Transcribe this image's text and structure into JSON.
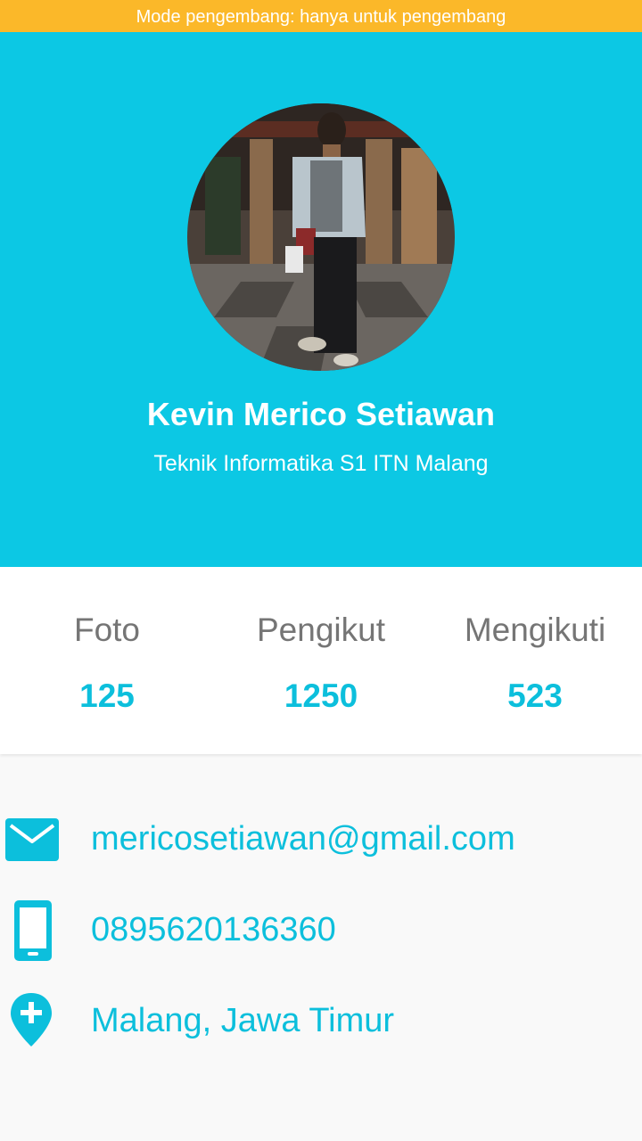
{
  "status_bar": {
    "dev_mode_text": "Mode pengembang: hanya untuk pengembang"
  },
  "profile": {
    "name": "Kevin Merico Setiawan",
    "subtitle": "Teknik Informatika S1 ITN Malang"
  },
  "stats": [
    {
      "label": "Foto",
      "value": "125"
    },
    {
      "label": "Pengikut",
      "value": "1250"
    },
    {
      "label": "Mengikuti",
      "value": "523"
    }
  ],
  "contact": {
    "email": "mericosetiawan@gmail.com",
    "phone": "0895620136360",
    "location": "Malang, Jawa Timur"
  },
  "icons": {
    "email": "mail-icon",
    "phone": "phone-icon",
    "location": "location-pin-icon"
  },
  "colors": {
    "banner": "#fbb829",
    "header": "#0cc8e4",
    "accent": "#0cbfdc",
    "label_gray": "#757575",
    "background": "#f9f9f9"
  }
}
